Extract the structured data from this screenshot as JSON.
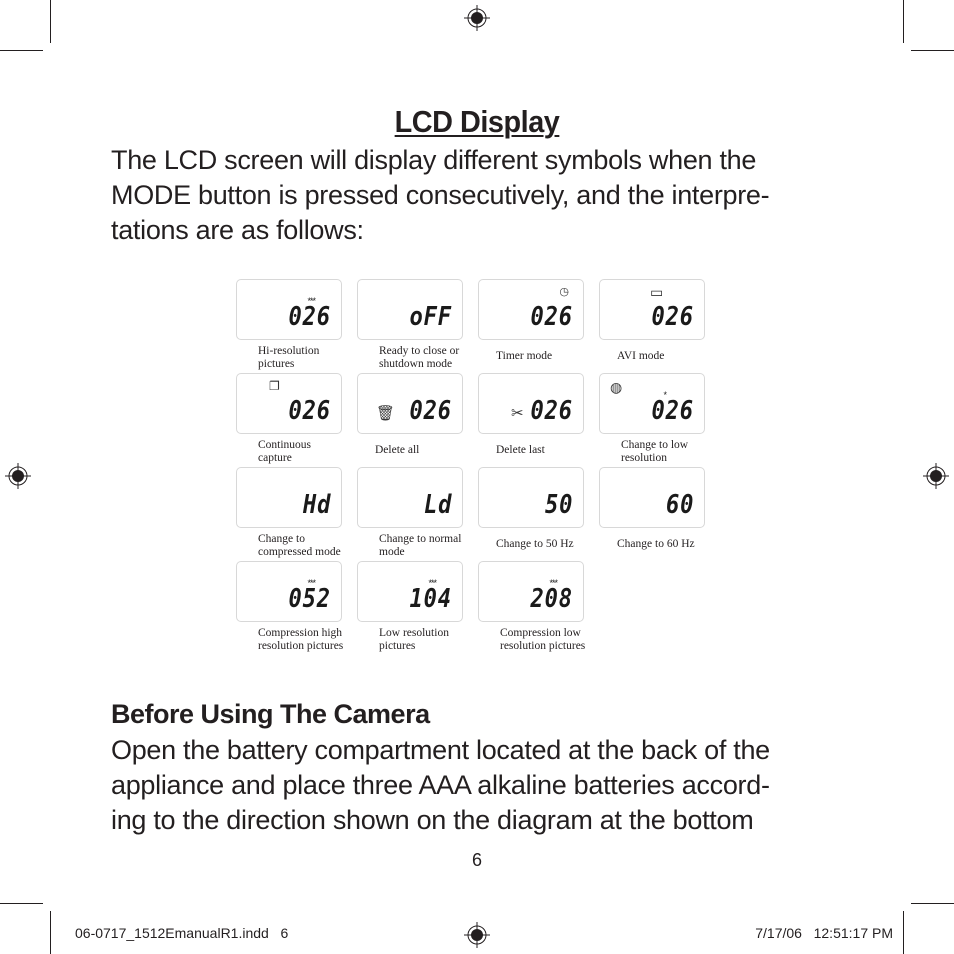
{
  "page": {
    "title": "LCD Display",
    "intro_lines": [
      "The LCD screen will display different symbols when the",
      "MODE button is pressed consecutively, and the interpre-",
      "tations are as follows:"
    ],
    "section_heading": "Before Using The Camera",
    "section_lines": [
      "Open the battery compartment located at the back of the",
      "appliance and place three AAA alkaline batteries accord-",
      "ing to the direction shown on the diagram at the bottom"
    ],
    "page_number": "6"
  },
  "lcd_modes": [
    {
      "display": "026",
      "indicator": "***",
      "icon": "",
      "caption": [
        "Hi-resolution",
        "pictures"
      ]
    },
    {
      "display": "oFF",
      "indicator": "",
      "icon": "",
      "caption": [
        "Ready to close or",
        "shutdown mode"
      ]
    },
    {
      "display": "026",
      "indicator": "",
      "icon": "timer-icon",
      "caption": [
        "Timer mode"
      ]
    },
    {
      "display": "026",
      "indicator": "",
      "icon": "video-camera-icon",
      "caption": [
        "AVI mode"
      ]
    },
    {
      "display": "026",
      "indicator": "",
      "icon": "continuous-capture-icon",
      "caption": [
        "Continuous",
        "capture"
      ]
    },
    {
      "display": "026",
      "indicator": "",
      "icon": "trash-can-icon",
      "caption": [
        "Delete all"
      ]
    },
    {
      "display": "026",
      "indicator": "",
      "icon": "scissors-icon",
      "caption": [
        "Delete last"
      ]
    },
    {
      "display": "026",
      "indicator": "*",
      "icon": "mode-icon",
      "caption": [
        "Change to low",
        "resolution"
      ]
    },
    {
      "display": "Hd",
      "indicator": "",
      "icon": "",
      "caption": [
        "Change to",
        "compressed mode"
      ]
    },
    {
      "display": "Ld",
      "indicator": "",
      "icon": "",
      "caption": [
        "Change to normal",
        "mode"
      ]
    },
    {
      "display": "50",
      "indicator": "",
      "icon": "",
      "caption": [
        "Change to 50 Hz"
      ]
    },
    {
      "display": "60",
      "indicator": "",
      "icon": "",
      "caption": [
        "Change to 60 Hz"
      ]
    },
    {
      "display": "052",
      "indicator": "***",
      "icon": "",
      "caption": [
        "Compression high",
        "resolution pictures"
      ]
    },
    {
      "display": "104",
      "indicator": "***",
      "icon": "",
      "caption": [
        "Low resolution",
        "pictures"
      ]
    },
    {
      "display": "208",
      "indicator": "***",
      "icon": "",
      "caption": [
        "Compression low",
        "resolution pictures"
      ]
    }
  ],
  "slug": {
    "file": "06-0717_1512EmanualR1.indd   6",
    "timestamp": "7/17/06   12:51:17 PM"
  },
  "icon_glyphs": {
    "timer-icon": "◷",
    "video-camera-icon": "▭",
    "continuous-capture-icon": "❐",
    "trash-can-icon": "🗑",
    "scissors-icon": "✂",
    "mode-icon": "◍"
  }
}
